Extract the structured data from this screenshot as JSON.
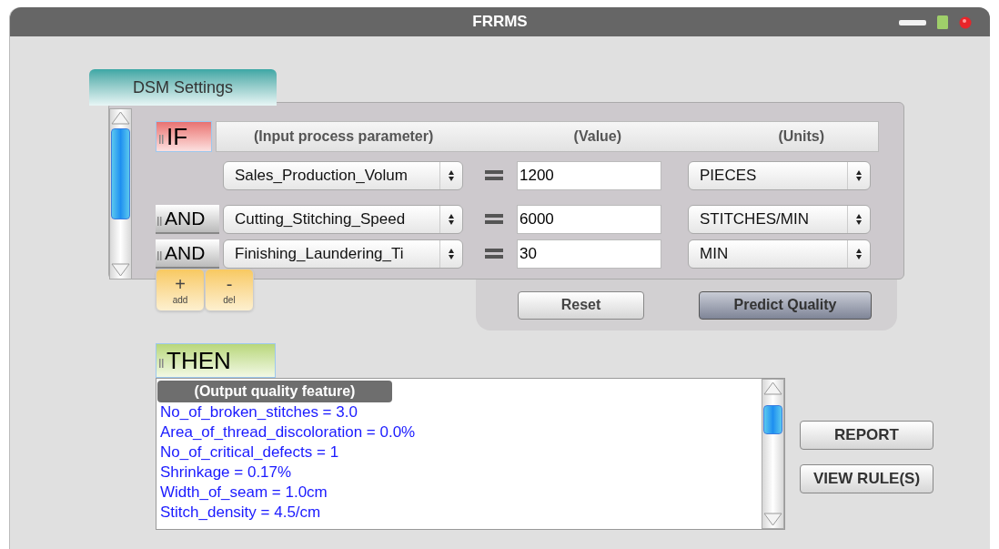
{
  "window": {
    "title": "FRRMS"
  },
  "tab": {
    "label": "DSM Settings"
  },
  "if_label": "IF",
  "columns": [
    "(Input process parameter)",
    "(Value)",
    "(Units)"
  ],
  "conditions": [
    {
      "parameter": "Sales_Production_Volum",
      "value": "1200",
      "unit": "PIECES"
    },
    {
      "connector": "AND",
      "parameter": "Cutting_Stitching_Speed",
      "value": "6000",
      "unit": "STITCHES/MIN"
    },
    {
      "connector": "AND",
      "parameter": "Finishing_Laundering_Ti",
      "value": "30",
      "unit": "MIN"
    }
  ],
  "row_tools": [
    {
      "symbol": "+",
      "label": "add"
    },
    {
      "symbol": "-",
      "label": "del"
    }
  ],
  "actions": [
    {
      "label": "Reset",
      "kind": "plain"
    },
    {
      "label": "Predict Quality",
      "kind": "default"
    }
  ],
  "then_label": "THEN",
  "output": {
    "header": "(Output quality feature)",
    "lines": [
      "No_of_broken_stitches = 3.0",
      "Area_of_thread_discoloration = 0.0%",
      "No_of_critical_defects = 1",
      "Shrinkage = 0.17%",
      "Width_of_seam = 1.0cm",
      "Stitch_density = 4.5/cm"
    ]
  },
  "side_buttons": [
    "REPORT",
    "VIEW RULE(S)"
  ]
}
